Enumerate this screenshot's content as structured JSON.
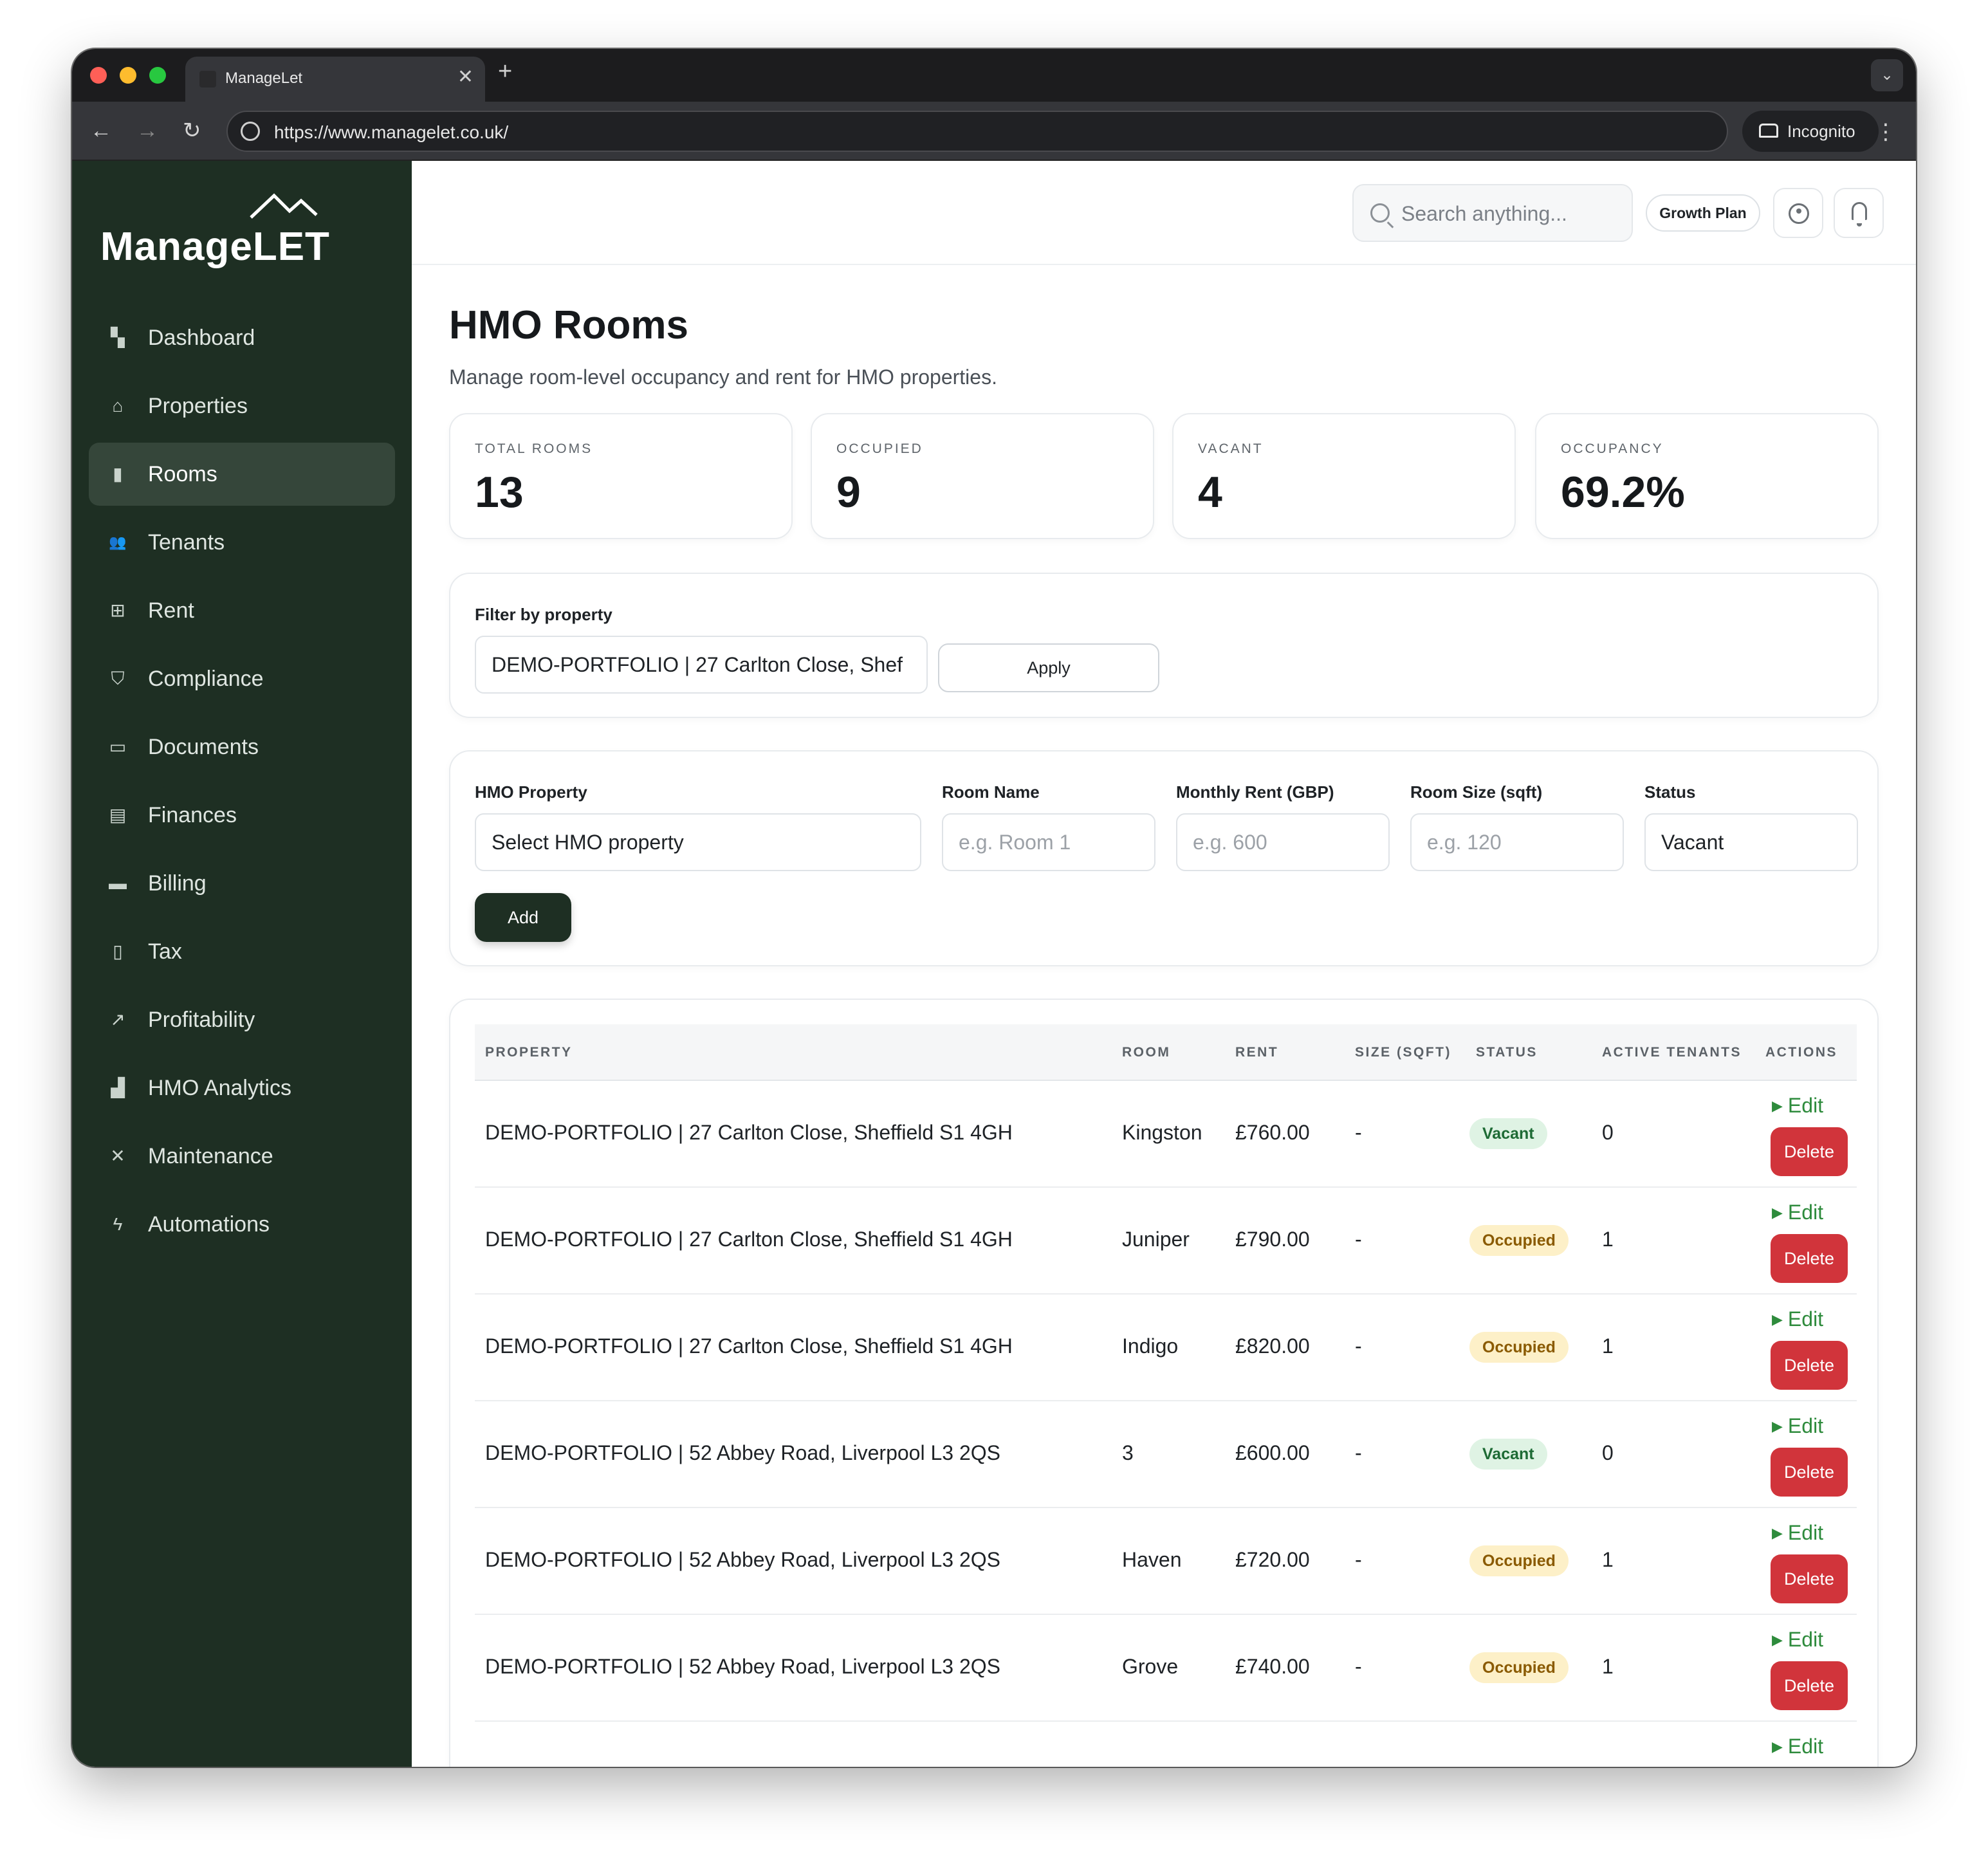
{
  "browser": {
    "tab_title": "ManageLet",
    "url": "https://www.managelet.co.uk/",
    "incognito_label": "Incognito"
  },
  "brand": {
    "logo_text": "ManageLET"
  },
  "sidebar": {
    "items": [
      {
        "label": "Dashboard",
        "icon": "dashboard-icon",
        "glyph": "▚",
        "active": false
      },
      {
        "label": "Properties",
        "icon": "properties-icon",
        "glyph": "⌂",
        "active": false
      },
      {
        "label": "Rooms",
        "icon": "door-icon",
        "glyph": "▮",
        "active": true
      },
      {
        "label": "Tenants",
        "icon": "tenants-icon",
        "glyph": "👥",
        "active": false
      },
      {
        "label": "Rent",
        "icon": "rent-icon",
        "glyph": "⊞",
        "active": false
      },
      {
        "label": "Compliance",
        "icon": "shield-icon",
        "glyph": "⛉",
        "active": false
      },
      {
        "label": "Documents",
        "icon": "folder-icon",
        "glyph": "▭",
        "active": false
      },
      {
        "label": "Finances",
        "icon": "ledger-icon",
        "glyph": "▤",
        "active": false
      },
      {
        "label": "Billing",
        "icon": "billing-icon",
        "glyph": "▬",
        "active": false
      },
      {
        "label": "Tax",
        "icon": "document-icon",
        "glyph": "▯",
        "active": false
      },
      {
        "label": "Profitability",
        "icon": "trend-icon",
        "glyph": "↗",
        "active": false
      },
      {
        "label": "HMO Analytics",
        "icon": "bar-chart-icon",
        "glyph": "▟",
        "active": false
      },
      {
        "label": "Maintenance",
        "icon": "tools-icon",
        "glyph": "✕",
        "active": false
      },
      {
        "label": "Automations",
        "icon": "bolt-icon",
        "glyph": "ϟ",
        "active": false
      }
    ]
  },
  "topbar": {
    "search_placeholder": "Search anything...",
    "plan_label": "Growth Plan"
  },
  "page": {
    "title": "HMO Rooms",
    "subtitle": "Manage room-level occupancy and rent for HMO properties."
  },
  "stats": [
    {
      "label": "TOTAL ROOMS",
      "value": "13"
    },
    {
      "label": "OCCUPIED",
      "value": "9"
    },
    {
      "label": "VACANT",
      "value": "4"
    },
    {
      "label": "OCCUPANCY",
      "value": "69.2%"
    }
  ],
  "filter": {
    "label": "Filter by property",
    "value": "DEMO-PORTFOLIO | 27 Carlton Close, Shef",
    "apply_label": "Apply"
  },
  "form": {
    "property_label": "HMO Property",
    "property_value": "Select HMO property",
    "room_label": "Room Name",
    "room_placeholder": "e.g. Room 1",
    "rent_label": "Monthly Rent (GBP)",
    "rent_placeholder": "e.g. 600",
    "size_label": "Room Size (sqft)",
    "size_placeholder": "e.g. 120",
    "status_label": "Status",
    "status_value": "Vacant",
    "add_label": "Add"
  },
  "table": {
    "columns": [
      "PROPERTY",
      "ROOM",
      "RENT",
      "SIZE (SQFT)",
      "STATUS",
      "ACTIVE TENANTS",
      "ACTIONS"
    ],
    "edit_label": "Edit",
    "delete_label": "Delete",
    "rows": [
      {
        "property": "DEMO-PORTFOLIO | 27 Carlton Close, Sheffield S1 4GH",
        "room": "Kingston",
        "rent": "£760.00",
        "size": "-",
        "status": "Vacant",
        "tenants": "0"
      },
      {
        "property": "DEMO-PORTFOLIO | 27 Carlton Close, Sheffield S1 4GH",
        "room": "Juniper",
        "rent": "£790.00",
        "size": "-",
        "status": "Occupied",
        "tenants": "1"
      },
      {
        "property": "DEMO-PORTFOLIO | 27 Carlton Close, Sheffield S1 4GH",
        "room": "Indigo",
        "rent": "£820.00",
        "size": "-",
        "status": "Occupied",
        "tenants": "1"
      },
      {
        "property": "DEMO-PORTFOLIO | 52 Abbey Road, Liverpool L3 2QS",
        "room": "3",
        "rent": "£600.00",
        "size": "-",
        "status": "Vacant",
        "tenants": "0"
      },
      {
        "property": "DEMO-PORTFOLIO | 52 Abbey Road, Liverpool L3 2QS",
        "room": "Haven",
        "rent": "£720.00",
        "size": "-",
        "status": "Occupied",
        "tenants": "1"
      },
      {
        "property": "DEMO-PORTFOLIO | 52 Abbey Road, Liverpool L3 2QS",
        "room": "Grove",
        "rent": "£740.00",
        "size": "-",
        "status": "Occupied",
        "tenants": "1"
      }
    ]
  },
  "colors": {
    "sidebar_bg": "#1e2f23",
    "accent_dark": "#1e2f23",
    "delete_red": "#d1343b",
    "edit_green": "#2e8b3c",
    "vacant_badge": "#dff3e4",
    "occupied_badge": "#fdf0c8"
  }
}
